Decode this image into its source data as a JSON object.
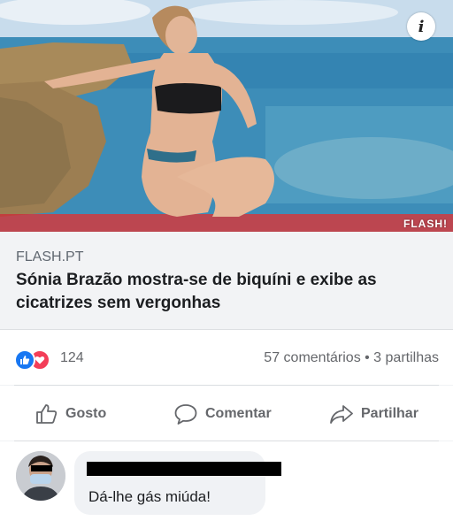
{
  "post": {
    "image": {
      "watermark": "FLASH!",
      "info_icon": "info-icon"
    },
    "link": {
      "source": "FLASH.PT",
      "headline": "Sónia Brazão mostra-se de biquíni e exibe as cicatrizes sem vergonhas"
    },
    "stats": {
      "reaction_icons": [
        "like-icon",
        "love-icon"
      ],
      "reaction_count": "124",
      "comments_shares": "57 comentários • 3 partilhas"
    },
    "actions": {
      "like_label": "Gosto",
      "comment_label": "Comentar",
      "share_label": "Partilhar"
    }
  },
  "comment": {
    "text": "Dá-lhe gás miúda!"
  },
  "colors": {
    "like_blue": "#1877f2",
    "love_red": "#f33e58",
    "secondary_text": "#65676b"
  }
}
